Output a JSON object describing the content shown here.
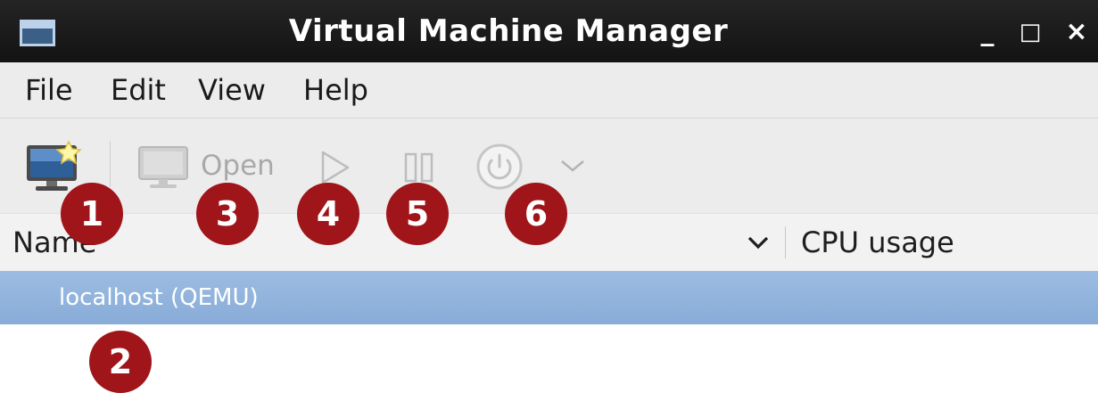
{
  "window": {
    "title": "Virtual Machine Manager",
    "controls": {
      "minimize": "_",
      "maximize": "□",
      "close": "×"
    }
  },
  "menu": {
    "items": [
      "File",
      "Edit",
      "View",
      "Help"
    ]
  },
  "toolbar": {
    "new_vm_icon": "new-vm-icon",
    "open_label": "Open",
    "run_icon": "play-icon",
    "pause_icon": "pause-icon",
    "shutdown_icon": "power-icon",
    "dropdown_icon": "chevron-down-icon"
  },
  "list": {
    "columns": {
      "name": "Name",
      "cpu": "CPU usage"
    },
    "rows": [
      {
        "label": "localhost (QEMU)"
      }
    ]
  },
  "callouts": [
    "1",
    "2",
    "3",
    "4",
    "5",
    "6"
  ],
  "colors": {
    "titlebar": "#1b1b1b",
    "selection": "#8fb1da",
    "callout": "#a0151a",
    "disabled_text": "#a9a9a9"
  }
}
